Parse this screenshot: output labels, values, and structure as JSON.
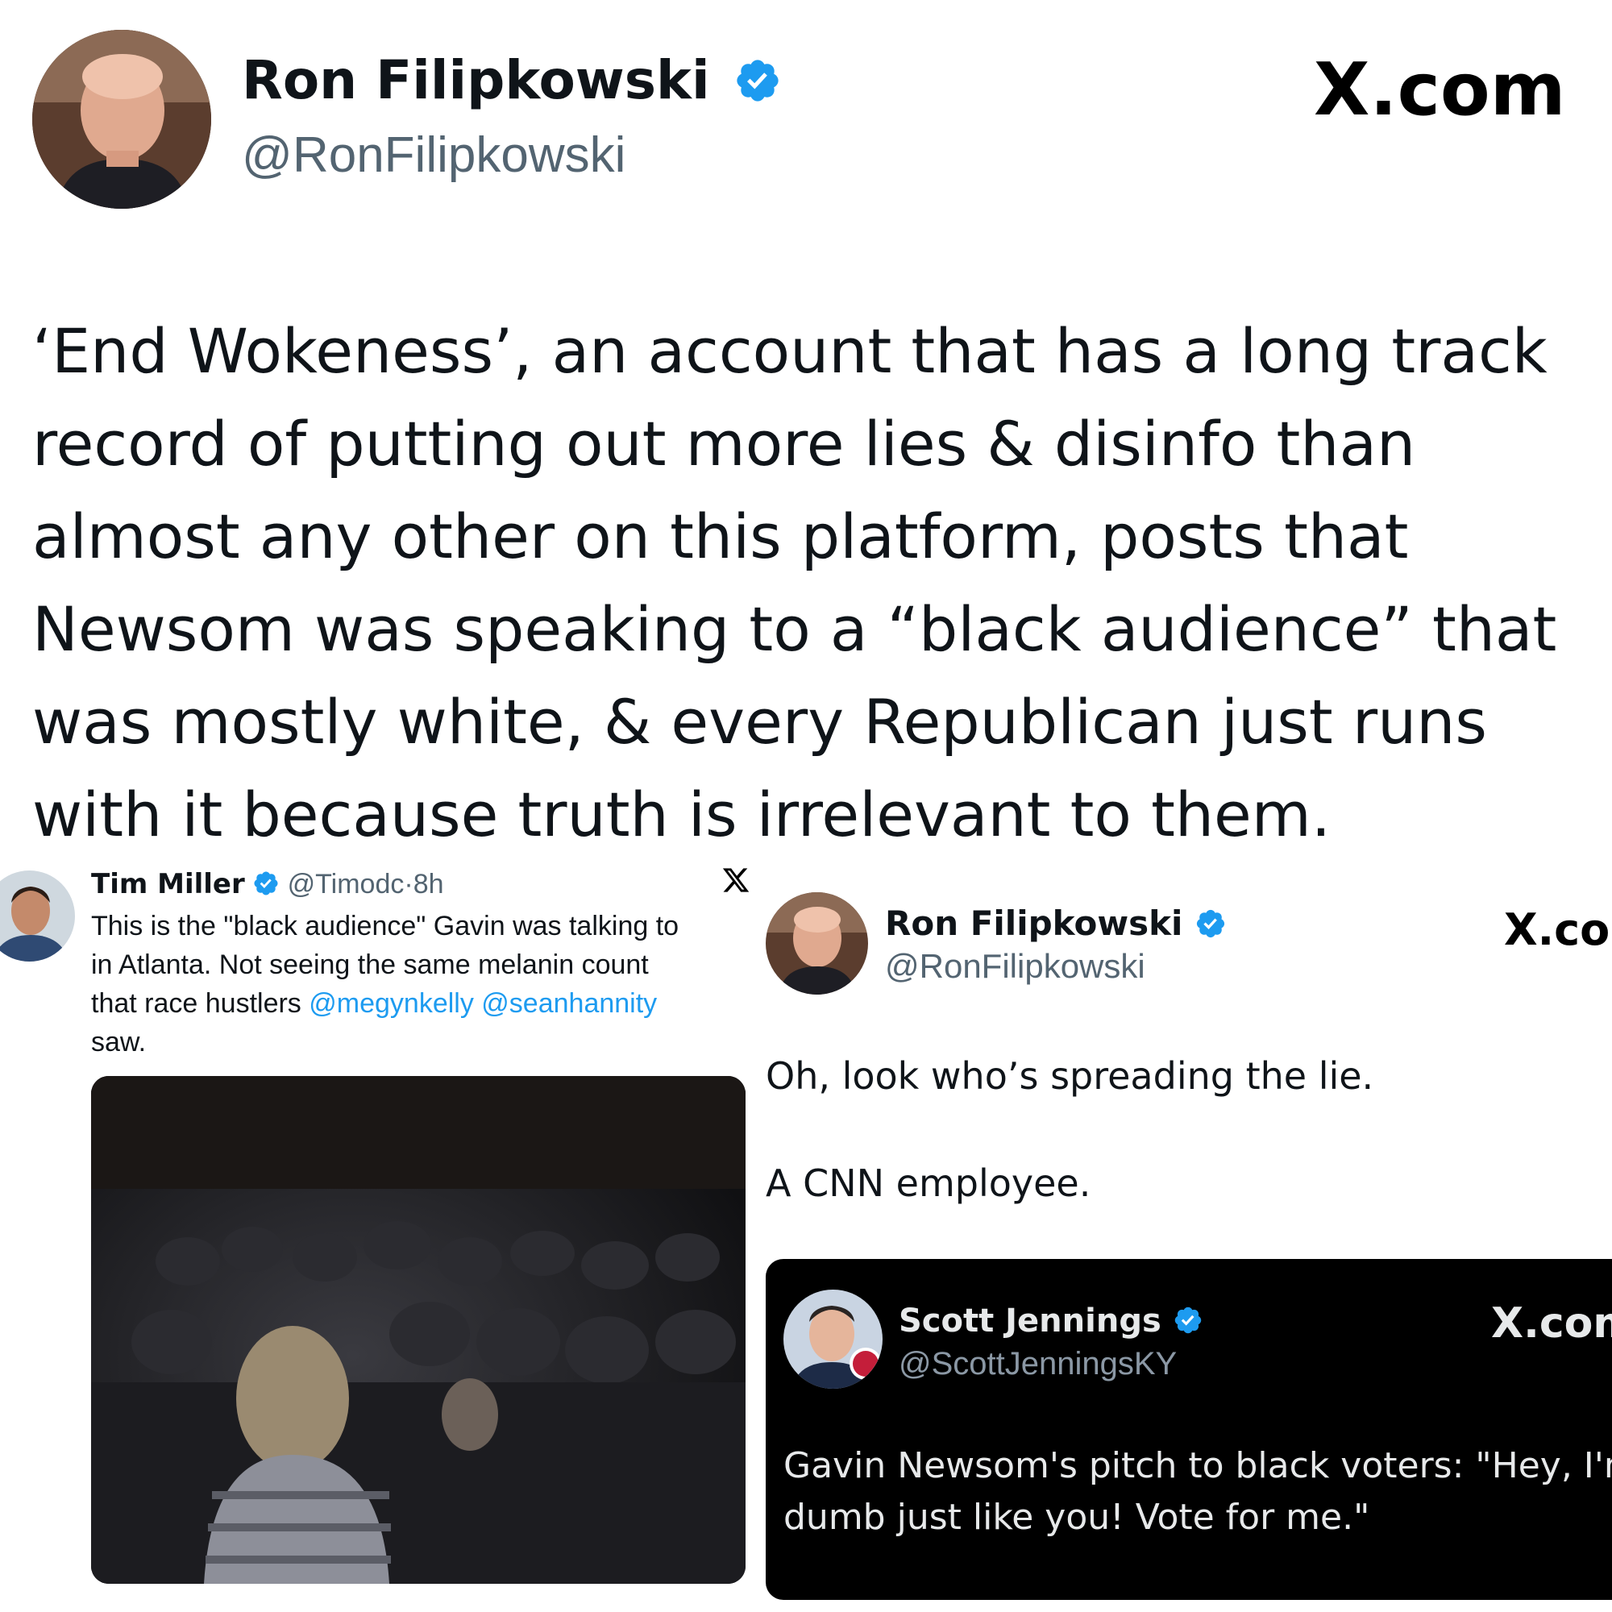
{
  "main_post": {
    "author_name": "Ron Filipkowski",
    "author_handle": "@RonFilipkowski",
    "site_label": "X.com",
    "body_lines": [
      "‘End Wokeness’, an account that has a long track",
      "record of putting out more lies & disinfo than",
      "almost any other on this platform, posts that",
      "Newsom was speaking to a “black audience” that",
      "was mostly white, & every Republican just runs",
      "with it because truth is irrelevant to them."
    ]
  },
  "embedded_tweet": {
    "author_name": "Tim Miller",
    "author_handle": "@Timodc",
    "separator": "·",
    "time_ago": "8h",
    "text_line1": "This is the \"black audience\" Gavin was talking to",
    "text_line2": "in Atlanta. Not seeing the same melanin count",
    "text_line3_prefix": "that race hustlers ",
    "mention1": "@megynkelly",
    "mention2": "@seanhannity",
    "text_line4": "saw.",
    "media_icon": "video-still"
  },
  "reply_post": {
    "author_name": "Ron Filipkowski",
    "author_handle": "@RonFilipkowski",
    "site_label": "X.com",
    "line1": "Oh, look who’s spreading the lie.",
    "line2": "A CNN employee."
  },
  "quoted_dark_post": {
    "author_name": "Scott Jennings",
    "author_handle": "@ScottJenningsKY",
    "site_label": "X.com",
    "text_line1": "Gavin Newsom's pitch to black voters: \"Hey, I'm",
    "text_line2": "dumb just like you! Vote for me.\""
  },
  "colors": {
    "verified_blue": "#1d9bf0",
    "link_blue": "#1d9bf0",
    "dark_card": "#000000"
  }
}
